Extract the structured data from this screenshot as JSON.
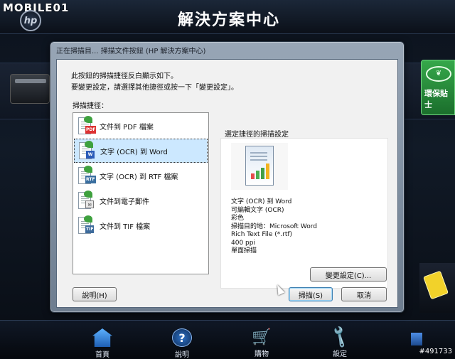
{
  "watermark": "MOBILE01",
  "hp_logo": "hp",
  "app": {
    "title": "解決方案中心"
  },
  "eco_tile": {
    "label": "環保貼士"
  },
  "bottom_id": "#491733",
  "nav": [
    {
      "label": "首頁",
      "icon": "home-icon"
    },
    {
      "label": "說明",
      "icon": "help-icon"
    },
    {
      "label": "購物",
      "icon": "shopping-cart-icon"
    },
    {
      "label": "設定",
      "icon": "wrench-icon"
    }
  ],
  "dialog": {
    "title": "正在掃描目... 掃描文件按鈕 (HP 解決方案中心)",
    "intro_line1": "此按鈕的掃描捷徑反白顯示如下。",
    "intro_line2": "要變更設定，請選擇其他捷徑或按一下「變更設定」。",
    "list_label": "掃描捷徑：",
    "shortcuts": [
      {
        "label": "文件到 PDF 檔案",
        "badge": "PDF"
      },
      {
        "label": "文字 (OCR) 到 Word",
        "badge": "W"
      },
      {
        "label": "文字 (OCR) 到 RTF 檔案",
        "badge": "RTF"
      },
      {
        "label": "文件到電子郵件",
        "badge": "✉"
      },
      {
        "label": "文件到 TIF 檔案",
        "badge": "TIF"
      }
    ],
    "selected_index": 1,
    "settings_label": "選定捷徑的掃描設定",
    "details": [
      "文字 (OCR) 到 Word",
      "可編輯文字 (OCR)",
      "彩色",
      "掃描目的地：Microsoft Word",
      "Rich Text File (*.rtf)",
      "400 ppi",
      "單面掃描"
    ],
    "change_settings_button": "變更設定(C)...",
    "help_button": "說明(H)",
    "scan_button": "掃描(S)",
    "cancel_button": "取消"
  }
}
